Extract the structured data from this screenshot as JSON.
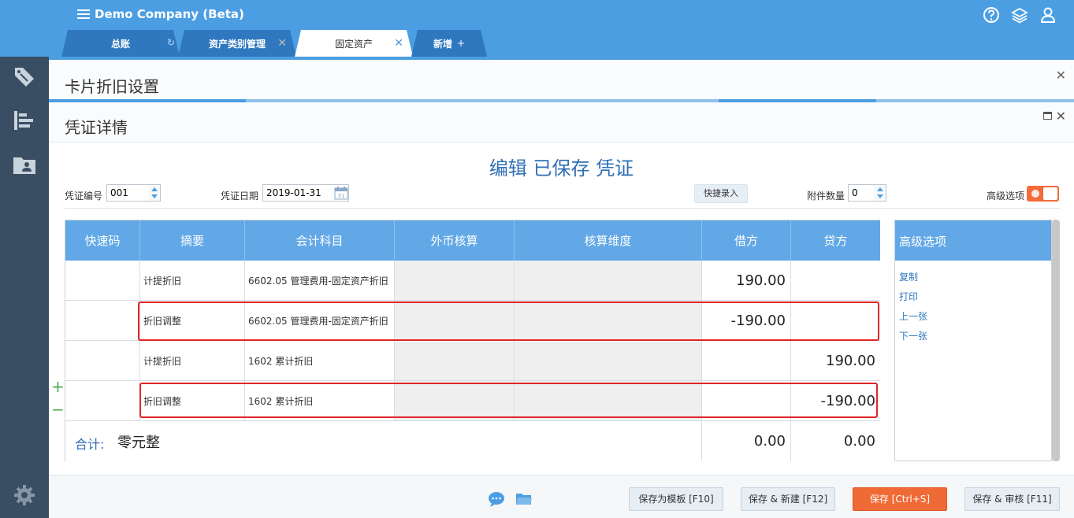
{
  "app": {
    "title": "Demo Company (Beta)"
  },
  "tabs": [
    {
      "label": "总账"
    },
    {
      "label": "资产类别管理"
    },
    {
      "label": "固定资产"
    },
    {
      "label": "新增"
    }
  ],
  "panel1": {
    "title": "卡片折旧设置"
  },
  "panel2": {
    "title": "凭证详情"
  },
  "voucher": {
    "heading": "编辑 已保存 凭证",
    "number_label": "凭证编号",
    "number": "001",
    "date_label": "凭证日期",
    "date": "2019-01-31",
    "quick_entry": "快捷录入",
    "attachments_label": "附件数量",
    "attachments": "0",
    "advanced_label": "高级选项"
  },
  "table": {
    "headers": [
      "快速码",
      "摘要",
      "会计科目",
      "外币核算",
      "核算维度",
      "借方",
      "贷方"
    ],
    "rows": [
      {
        "code": "",
        "summary": "计提折旧",
        "account": "6602.05 管理费用-固定资产折旧",
        "debit": "190.00",
        "credit": ""
      },
      {
        "code": "",
        "summary": "折旧调整",
        "account": "6602.05 管理费用-固定资产折旧",
        "debit": "-190.00",
        "credit": ""
      },
      {
        "code": "",
        "summary": "计提折旧",
        "account": "1602 累计折旧",
        "debit": "",
        "credit": "190.00"
      },
      {
        "code": "",
        "summary": "折旧调整",
        "account": "1602 累计折旧",
        "debit": "",
        "credit": "-190.00"
      }
    ],
    "total_label": "合计:",
    "total_words": "零元整",
    "total_debit": "0.00",
    "total_credit": "0.00"
  },
  "advanced": {
    "title": "高级选项",
    "links": [
      "复制",
      "打印",
      "上一张",
      "下一张"
    ]
  },
  "footer": {
    "buttons": [
      "保存为模板 [F10]",
      "保存 & 新建 [F12]",
      "保存 [Ctrl+S]",
      "保存 & 审核 [F11]"
    ]
  },
  "colors": {
    "header_blue": "#4c9ee2",
    "primary_orange": "#f06a36",
    "highlight_red": "#e02626"
  }
}
